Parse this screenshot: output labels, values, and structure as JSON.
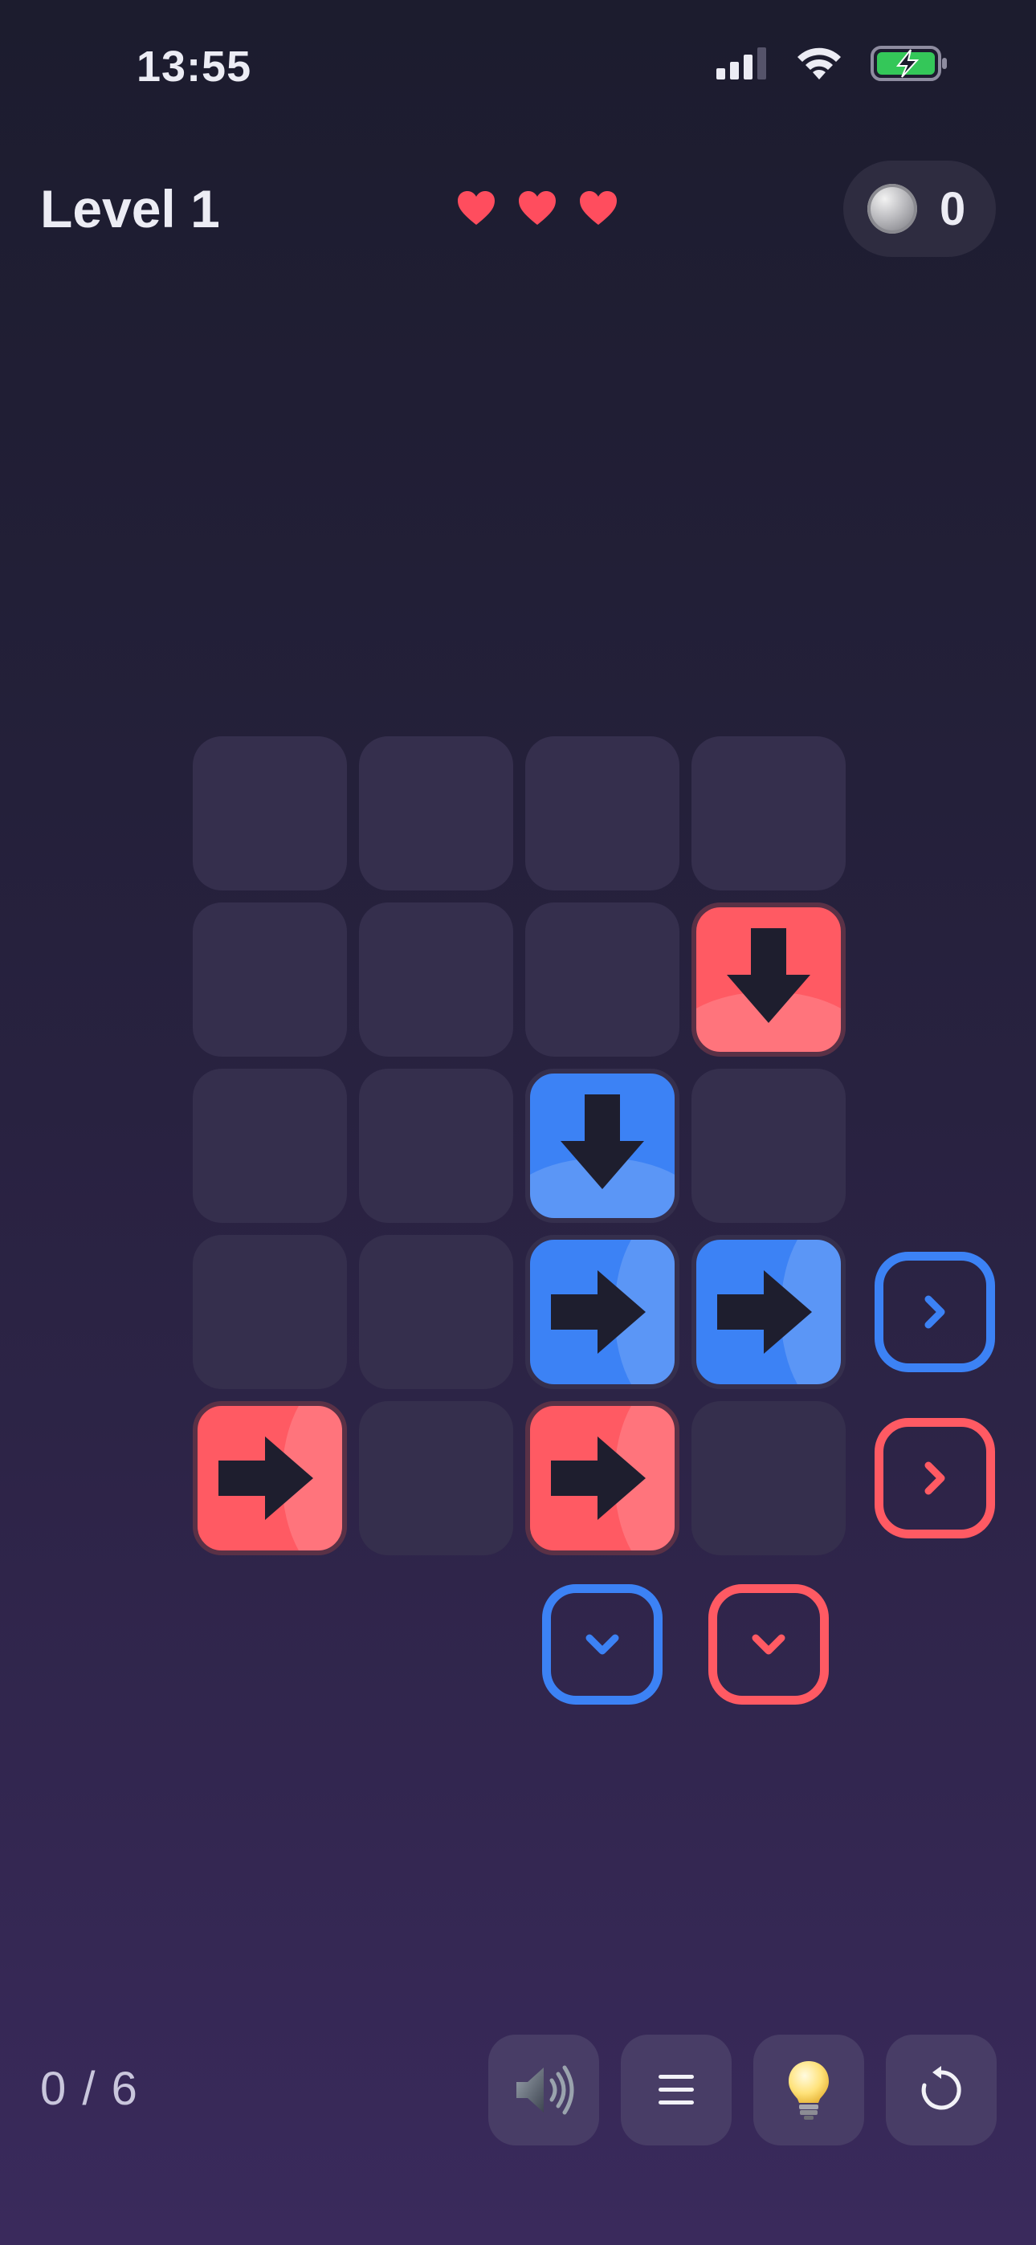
{
  "status_bar": {
    "time": "13:55",
    "icons": [
      "signal-icon",
      "wifi-icon",
      "battery-charging-icon"
    ]
  },
  "header": {
    "level_label": "Level 1",
    "lives": 3,
    "coins": "0",
    "icons": [
      "heart-icon",
      "coin-icon"
    ]
  },
  "board": {
    "rows": 5,
    "cols": 4,
    "tiles": [
      {
        "row": 1,
        "col": 3,
        "color": "red",
        "direction": "down"
      },
      {
        "row": 2,
        "col": 2,
        "color": "blue",
        "direction": "down"
      },
      {
        "row": 3,
        "col": 2,
        "color": "blue",
        "direction": "right"
      },
      {
        "row": 3,
        "col": 3,
        "color": "blue",
        "direction": "right"
      },
      {
        "row": 4,
        "col": 0,
        "color": "red",
        "direction": "right"
      },
      {
        "row": 4,
        "col": 2,
        "color": "red",
        "direction": "right"
      }
    ],
    "exits": [
      {
        "side": "right",
        "row": 3,
        "color": "blue",
        "direction": "right"
      },
      {
        "side": "right",
        "row": 4,
        "color": "red",
        "direction": "right"
      },
      {
        "side": "bottom",
        "col": 2,
        "color": "blue",
        "direction": "down"
      },
      {
        "side": "bottom",
        "col": 3,
        "color": "red",
        "direction": "down"
      }
    ]
  },
  "colors": {
    "red": "#ff5a63",
    "blue": "#3c82f5",
    "arrow": "#1e1e2e",
    "empty_cell": "#352f4d"
  },
  "footer": {
    "progress": "0 / 6",
    "buttons": [
      "speaker-icon",
      "menu-icon",
      "lightbulb-icon",
      "restart-icon"
    ]
  }
}
